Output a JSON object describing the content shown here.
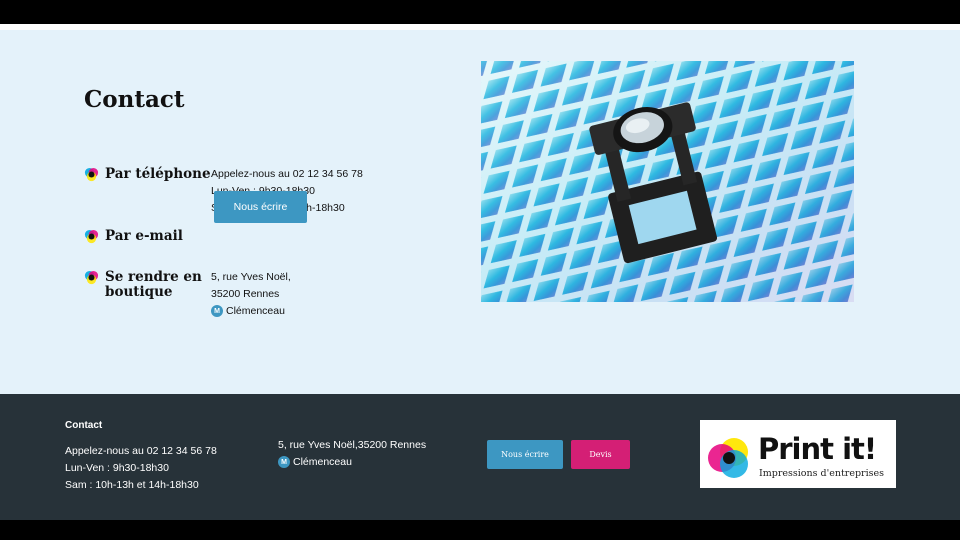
{
  "contact": {
    "title": "Contact",
    "phone": {
      "label": "Par téléphone",
      "line1": "Appelez-nous au 02 12 34 56 78",
      "line2": "Lun-Ven : 9h30-18h30",
      "line3": "Sam : 10h-13h et 14h-18h30"
    },
    "email": {
      "label": "Par e-mail",
      "button": "Nous écrire"
    },
    "shop": {
      "label_line1": "Se rendre en",
      "label_line2": "boutique",
      "address1": "5, rue Yves Noël,",
      "address2": "35200 Rennes",
      "metro_badge": "M",
      "metro": "Clémenceau"
    }
  },
  "footer": {
    "title": "Contact",
    "phone_line": "Appelez-nous au 02 12 34 56 78",
    "hours1": "Lun-Ven : 9h30-18h30",
    "hours2": "Sam : 10h-13h et 14h-18h30",
    "address": "5, rue Yves Noël,35200 Rennes",
    "metro_badge": "M",
    "metro": "Clémenceau",
    "btn_write": "Nous écrire",
    "btn_quote": "Devis",
    "logo_main": "Print it!",
    "logo_sub": "Impressions d'entreprises"
  },
  "colors": {
    "section_bg": "#e4f2fa",
    "footer_bg": "#273239",
    "accent_blue": "#3d97c2",
    "accent_pink": "#d41f75"
  },
  "icons": [
    "cmyk-dot-icon",
    "metro-icon",
    "loupe-illustration",
    "print-it-logo"
  ]
}
